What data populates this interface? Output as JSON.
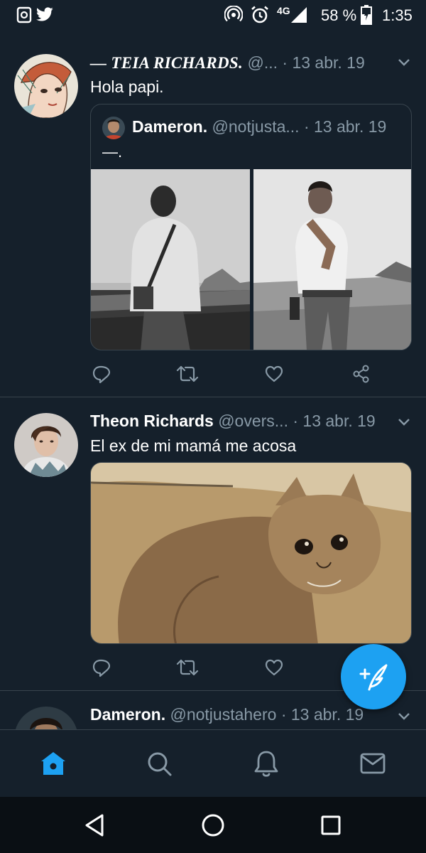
{
  "status_bar": {
    "network": "4G",
    "battery": "58 %",
    "time": "1:35"
  },
  "tweets": [
    {
      "name": "— TEIA RICHARDS.",
      "handle": "@...",
      "date": "· 13 abr. 19",
      "text": "Hola papi.",
      "quote": {
        "name": "Dameron.",
        "handle": "@notjusta...",
        "date": "· 13 abr. 19",
        "text": "—."
      }
    },
    {
      "name": "Theon Richards",
      "handle": "@overs...",
      "date": "· 13 abr. 19",
      "text": "El ex de mi mamá me acosa"
    },
    {
      "name": "Dameron.",
      "handle": "@notjustahero",
      "date": "· 13 abr. 19"
    }
  ],
  "icons": {
    "reply": "reply-icon",
    "retweet": "retweet-icon",
    "like": "like-icon",
    "share": "share-icon",
    "compose": "compose-icon",
    "home": "home-icon",
    "search": "search-icon",
    "notifications": "bell-icon",
    "messages": "mail-icon"
  },
  "colors": {
    "background": "#15202b",
    "accent": "#1da1f2",
    "secondary_text": "#8899a6",
    "border": "#38444d"
  }
}
